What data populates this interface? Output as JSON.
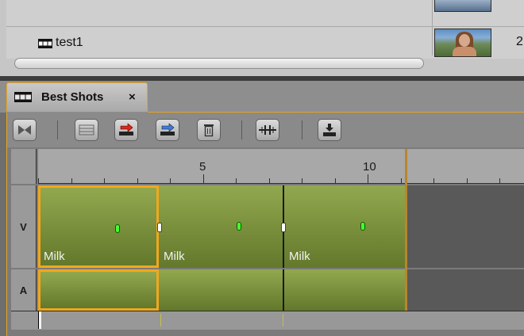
{
  "bin": {
    "clip_name": "test1",
    "side_value": "2"
  },
  "sequence": {
    "tab_label": "Best Shots",
    "tab_close": "×"
  },
  "toolbar": {
    "buttons": [
      "toggle-source-record-icon",
      "trim-icon",
      "lift-icon",
      "extract-icon",
      "delete-icon",
      "add-edit-icon",
      "export-icon"
    ]
  },
  "ruler": {
    "labels": [
      "5",
      "10"
    ]
  },
  "tracks": {
    "video_label": "V",
    "audio_label": "A"
  },
  "clips": {
    "c1": "Milk",
    "c2": "Milk",
    "c3": "Milk"
  },
  "colors": {
    "accent": "#f0a81e",
    "clip_green": "#7d9440",
    "marker": "#45ff2f"
  }
}
